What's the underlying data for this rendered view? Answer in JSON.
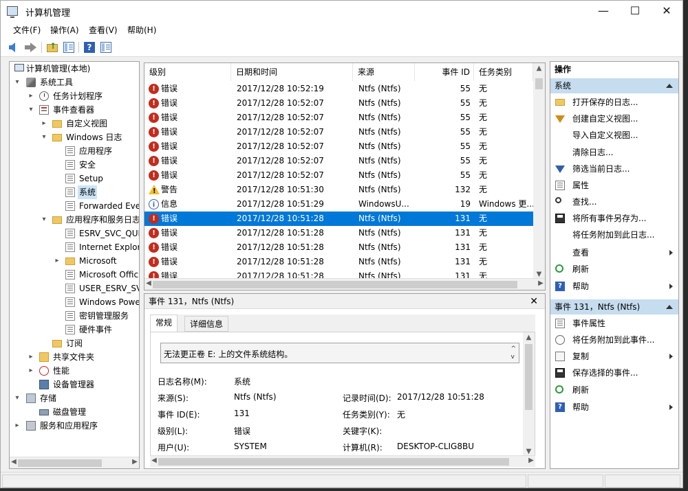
{
  "window": {
    "title": "计算机管理",
    "min_glyph": "—",
    "max_glyph": "☐",
    "close_glyph": "✕"
  },
  "menu": {
    "file": "文件(F)",
    "action": "操作(A)",
    "view": "查看(V)",
    "help": "帮助(H)"
  },
  "toolbar": {
    "icons": [
      "back-arrow-icon",
      "forward-arrow-icon",
      "up-folder-icon",
      "show-hide-tree-icon",
      "help-icon",
      "action-pane-icon"
    ]
  },
  "tree": {
    "expand_glyph": "▾",
    "collapse_glyph": "▸",
    "root": "计算机管理(本地)",
    "system_tools": "系统工具",
    "task_scheduler": "任务计划程序",
    "event_viewer": "事件查看器",
    "custom_views": "自定义视图",
    "windows_logs": "Windows 日志",
    "application": "应用程序",
    "security": "安全",
    "setup": "Setup",
    "system": "系统",
    "forwarded": "Forwarded Eve",
    "apps_services_logs": "应用程序和服务日志",
    "esrv_svc": "ESRV_SVC_QUE",
    "internet_explorer": "Internet Explor",
    "microsoft": "Microsoft",
    "microsoft_office": "Microsoft Offic",
    "user_esrv": "USER_ESRV_SV",
    "windows_powershell": "Windows Powe",
    "key_mgmt": "密钥管理服务",
    "hardware_events": "硬件事件",
    "subscriptions": "订阅",
    "shared_folders": "共享文件夹",
    "performance": "性能",
    "device_manager": "设备管理器",
    "storage": "存储",
    "disk_management": "磁盘管理",
    "services_apps": "服务和应用程序"
  },
  "event_list": {
    "columns": {
      "level": "级别",
      "datetime": "日期和时间",
      "source": "来源",
      "event_id": "事件 ID",
      "task_category": "任务类别"
    },
    "rows": [
      {
        "level": "错误",
        "kind": "err",
        "datetime": "2017/12/28 10:52:19",
        "source": "Ntfs (Ntfs)",
        "id": "55",
        "task": "无"
      },
      {
        "level": "错误",
        "kind": "err",
        "datetime": "2017/12/28 10:52:07",
        "source": "Ntfs (Ntfs)",
        "id": "55",
        "task": "无"
      },
      {
        "level": "错误",
        "kind": "err",
        "datetime": "2017/12/28 10:52:07",
        "source": "Ntfs (Ntfs)",
        "id": "55",
        "task": "无"
      },
      {
        "level": "错误",
        "kind": "err",
        "datetime": "2017/12/28 10:52:07",
        "source": "Ntfs (Ntfs)",
        "id": "55",
        "task": "无"
      },
      {
        "level": "错误",
        "kind": "err",
        "datetime": "2017/12/28 10:52:07",
        "source": "Ntfs (Ntfs)",
        "id": "55",
        "task": "无"
      },
      {
        "level": "错误",
        "kind": "err",
        "datetime": "2017/12/28 10:52:07",
        "source": "Ntfs (Ntfs)",
        "id": "55",
        "task": "无"
      },
      {
        "level": "错误",
        "kind": "err",
        "datetime": "2017/12/28 10:52:07",
        "source": "Ntfs (Ntfs)",
        "id": "55",
        "task": "无"
      },
      {
        "level": "警告",
        "kind": "warn",
        "datetime": "2017/12/28 10:51:30",
        "source": "Ntfs (Ntfs)",
        "id": "132",
        "task": "无"
      },
      {
        "level": "信息",
        "kind": "info",
        "datetime": "2017/12/28 10:51:29",
        "source": "WindowsU...",
        "id": "19",
        "task": "Windows 更..."
      },
      {
        "level": "错误",
        "kind": "err",
        "datetime": "2017/12/28 10:51:28",
        "source": "Ntfs (Ntfs)",
        "id": "131",
        "task": "无",
        "selected": true
      },
      {
        "level": "错误",
        "kind": "err",
        "datetime": "2017/12/28 10:51:28",
        "source": "Ntfs (Ntfs)",
        "id": "131",
        "task": "无"
      },
      {
        "level": "错误",
        "kind": "err",
        "datetime": "2017/12/28 10:51:28",
        "source": "Ntfs (Ntfs)",
        "id": "131",
        "task": "无"
      },
      {
        "level": "错误",
        "kind": "err",
        "datetime": "2017/12/28 10:51:28",
        "source": "Ntfs (Ntfs)",
        "id": "131",
        "task": "无"
      },
      {
        "level": "错误",
        "kind": "err",
        "datetime": "2017/12/28 10:51:28",
        "source": "Ntfs (Ntfs)",
        "id": "131",
        "task": "无"
      },
      {
        "level": "错误",
        "kind": "err",
        "datetime": "2017/12/28 10:51:28",
        "source": "Ntfs (Ntfs)",
        "id": "131",
        "task": "无"
      }
    ]
  },
  "detail": {
    "header": "事件 131，Ntfs (Ntfs)",
    "close_glyph": "✕",
    "tab_general": "常规",
    "tab_details": "详细信息",
    "description": "无法更正卷 E: 上的文件系统结构。",
    "log_name_label": "日志名称(M):",
    "log_name": "系统",
    "source_label": "来源(S):",
    "source": "Ntfs (Ntfs)",
    "logged_label": "记录时间(D):",
    "logged": "2017/12/28 10:51:28",
    "event_id_label": "事件 ID(E):",
    "event_id": "131",
    "task_label": "任务类别(Y):",
    "task": "无",
    "level_label": "级别(L):",
    "level": "错误",
    "keywords_label": "关键字(K):",
    "keywords": "",
    "user_label": "用户(U):",
    "user": "SYSTEM",
    "computer_label": "计算机(R):",
    "computer": "DESKTOP-CLIG8BU"
  },
  "actions": {
    "title": "操作",
    "section_system": "系统",
    "open_saved_log": "打开保存的日志...",
    "create_custom_view": "创建自定义视图...",
    "import_custom_view": "导入自定义视图...",
    "clear_log": "清除日志...",
    "filter_current_log": "筛选当前日志...",
    "properties": "属性",
    "find": "查找...",
    "save_all_events_as": "将所有事件另存为...",
    "attach_task_to_log": "将任务附加到此日志...",
    "view": "查看",
    "refresh": "刷新",
    "help": "帮助",
    "section_event": "事件 131，Ntfs (Ntfs)",
    "event_properties": "事件属性",
    "attach_task_to_event": "将任务附加到此事件...",
    "copy": "复制",
    "save_selected_events": "保存选择的事件...",
    "refresh2": "刷新",
    "help2": "帮助"
  },
  "scroll": {
    "up": "▲",
    "down": "▼",
    "left": "◀",
    "right": "▶"
  },
  "colors": {
    "selection": "#0078d7",
    "error": "#c42b1c",
    "warning": "#f2c029",
    "section_header": "#c6dcef"
  }
}
